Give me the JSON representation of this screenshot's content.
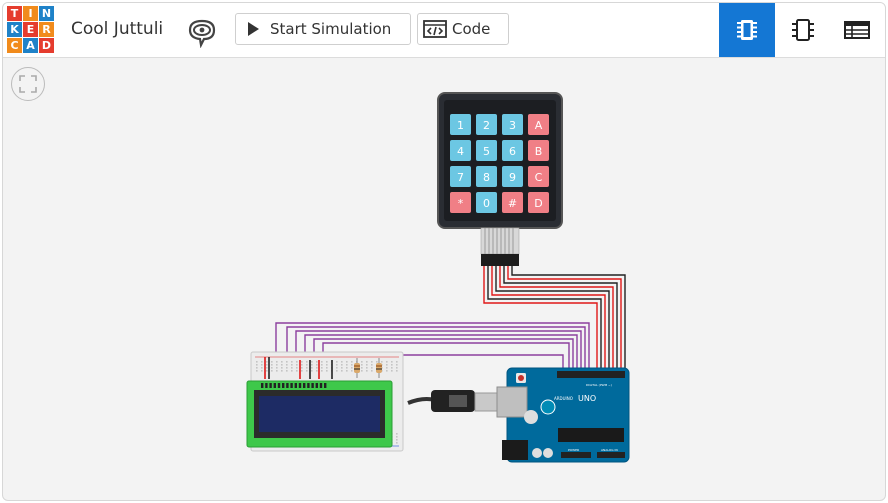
{
  "app": {
    "logo_letters": [
      "T",
      "I",
      "N",
      "K",
      "E",
      "R",
      "C",
      "A",
      "D"
    ],
    "project_name": "Cool Juttuli"
  },
  "toolbar": {
    "start_simulation_label": "Start Simulation",
    "code_label": "Code",
    "views": [
      {
        "name": "circuit-view",
        "active": true
      },
      {
        "name": "component-view",
        "active": false
      },
      {
        "name": "schematic-list-view",
        "active": false
      }
    ]
  },
  "keypad": {
    "keys": [
      "1",
      "2",
      "3",
      "A",
      "4",
      "5",
      "6",
      "B",
      "7",
      "8",
      "9",
      "C",
      "*",
      "0",
      "#",
      "D"
    ]
  },
  "arduino": {
    "brand": "ARDUINO",
    "model": "UNO",
    "header_digital": "DIGITAL (PWM ~)",
    "header_power": "POWER",
    "header_analog": "ANALOG IN"
  },
  "colors": {
    "accent": "#1477d4",
    "keypad_blue": "#6cc7e3",
    "keypad_red": "#f07f86",
    "board_blue": "#006a9c",
    "wire_red": "#e01818",
    "wire_black": "#222222",
    "wire_purple": "#8c3f9e",
    "lcd_green": "#3ec84a",
    "lcd_screen": "#1d2b64"
  }
}
